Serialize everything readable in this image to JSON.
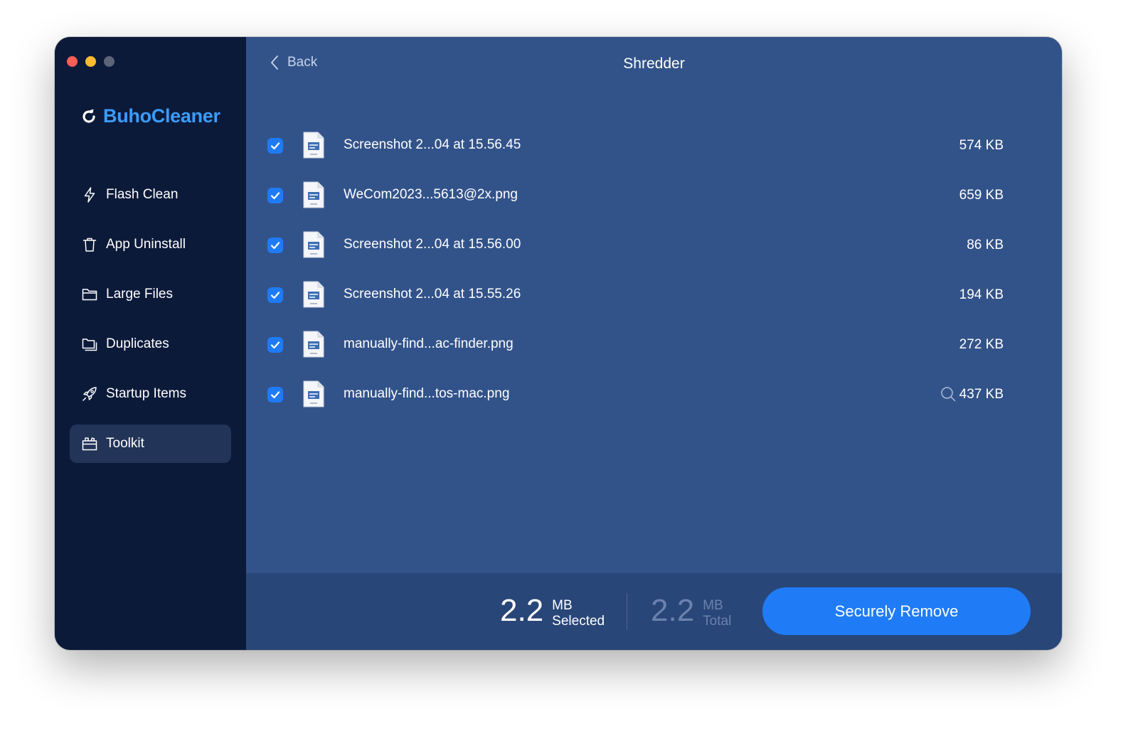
{
  "app": {
    "name": "BuhoCleaner"
  },
  "sidebar": {
    "items": [
      {
        "label": "Flash Clean",
        "icon": "lightning-icon",
        "active": false
      },
      {
        "label": "App Uninstall",
        "icon": "trash-icon",
        "active": false
      },
      {
        "label": "Large Files",
        "icon": "folder-icon",
        "active": false
      },
      {
        "label": "Duplicates",
        "icon": "duplicate-folder-icon",
        "active": false
      },
      {
        "label": "Startup Items",
        "icon": "rocket-icon",
        "active": false
      },
      {
        "label": "Toolkit",
        "icon": "toolbox-icon",
        "active": true
      }
    ]
  },
  "header": {
    "back_label": "Back",
    "title": "Shredder"
  },
  "files": [
    {
      "name": "Screenshot 2...04 at 15.56.45",
      "size": "574 KB",
      "checked": true
    },
    {
      "name": "WeCom2023...5613@2x.png",
      "size": "659 KB",
      "checked": true
    },
    {
      "name": "Screenshot 2...04 at 15.56.00",
      "size": "86 KB",
      "checked": true
    },
    {
      "name": "Screenshot 2...04 at 15.55.26",
      "size": "194 KB",
      "checked": true
    },
    {
      "name": "manually-find...ac-finder.png",
      "size": "272 KB",
      "checked": true
    },
    {
      "name": "manually-find...tos-mac.png",
      "size": "437 KB",
      "checked": true,
      "has_preview_icon": true
    }
  ],
  "footer": {
    "selected_value": "2.2",
    "selected_unit": "MB",
    "selected_label": "Selected",
    "total_value": "2.2",
    "total_unit": "MB",
    "total_label": "Total",
    "action_label": "Securely Remove"
  },
  "colors": {
    "accent": "#1f7cf6",
    "brand": "#3b9cff",
    "sidebar_bg": "#0c1a3a",
    "main_bg": "#32538a"
  }
}
